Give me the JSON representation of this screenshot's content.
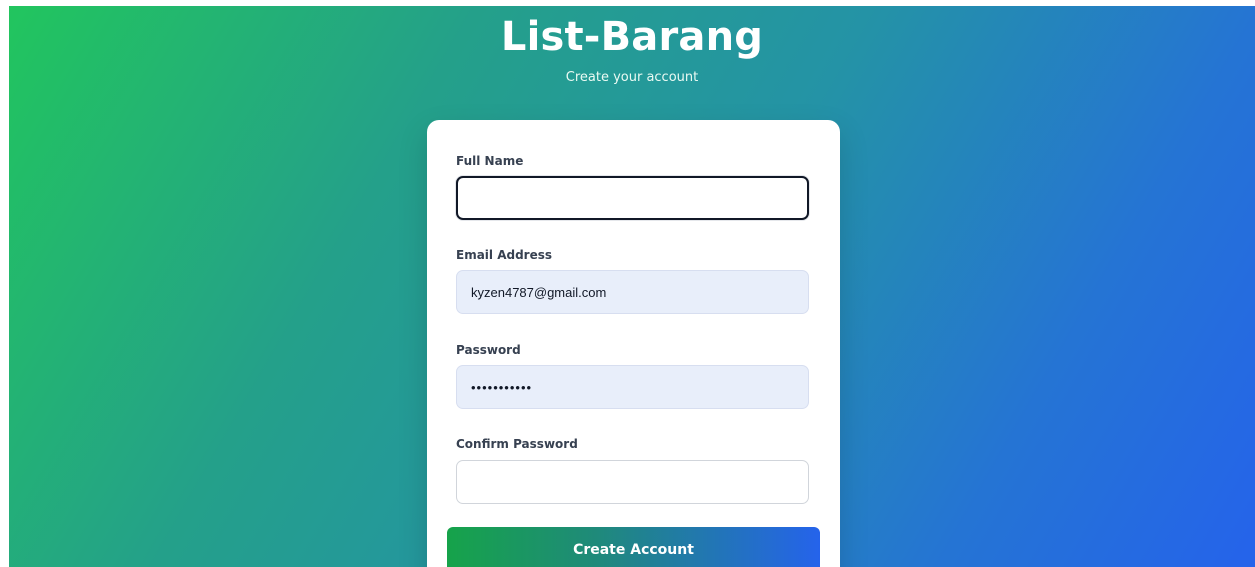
{
  "header": {
    "title": "List-Barang",
    "subtitle": "Create your account"
  },
  "form": {
    "full_name": {
      "label": "Full Name",
      "value": "",
      "placeholder": ""
    },
    "email": {
      "label": "Email Address",
      "value": "kyzen4787@gmail.com",
      "placeholder": ""
    },
    "password": {
      "label": "Password",
      "value": "•••••••••••",
      "placeholder": ""
    },
    "confirm_password": {
      "label": "Confirm Password",
      "value": "",
      "placeholder": ""
    },
    "submit_label": "Create Account"
  },
  "colors": {
    "gradient_start": "#22c55e",
    "gradient_end": "#2563eb",
    "autofill_background": "#e8eefa",
    "card_background": "#ffffff"
  }
}
